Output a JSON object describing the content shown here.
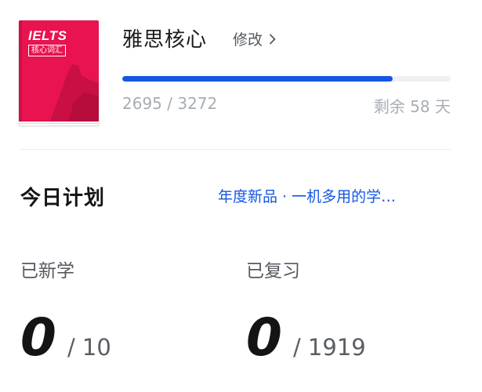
{
  "book": {
    "cover_title": "IELTS",
    "cover_tag": "核心词汇",
    "name": "雅思核心",
    "edit_label": "修改",
    "learned": 2695,
    "total": 3272,
    "progress_text": "2695 / 3272",
    "progress_fraction": 0.8237,
    "remaining_text": "剩余 58 天"
  },
  "plan": {
    "title": "今日计划",
    "promo_text": "年度新品 · 一机多用的学…",
    "new_learned": {
      "label": "已新学",
      "value": "0",
      "total_text": "/ 10"
    },
    "reviewed": {
      "label": "已复习",
      "value": "0",
      "total_text": "/ 1919"
    }
  },
  "colors": {
    "accent": "#1556e3",
    "cover": "#e8134f",
    "muted_text": "#a7adb4"
  }
}
